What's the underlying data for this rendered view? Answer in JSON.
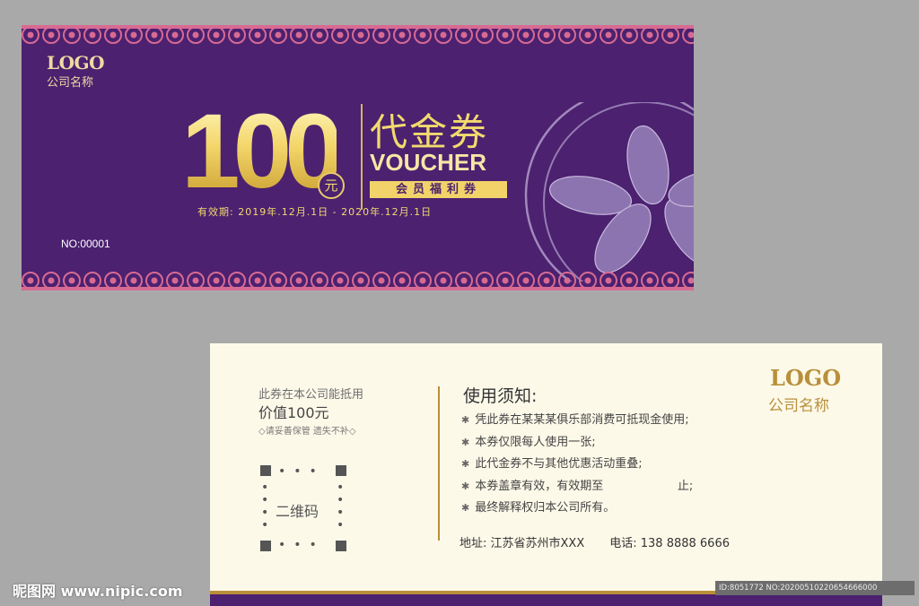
{
  "front": {
    "logo": "LOGO",
    "company": "公司名称",
    "amount": "100",
    "currency": "元",
    "title_cn": "代金券",
    "title_en": "VOUCHER",
    "member_label": "会员福利券",
    "validity": "有效期: 2019年.12月.1日  -  2020年.12月.1日",
    "serial": "NO:00001"
  },
  "back": {
    "value_line1": "此券在本公司能抵用",
    "value_line2": "价值100元",
    "keep_note": "◇请妥善保管 遗失不补◇",
    "qr_label": "二维码",
    "rules_title": "使用须知:",
    "rules": [
      "凭此券在某某某俱乐部消费可抵现金使用;",
      "本券仅限每人使用一张;",
      "此代金券不与其他优惠活动重叠;",
      "本券盖章有效，有效期至                    止;",
      "最终解释权归本公司所有。"
    ],
    "address": "地址: 江苏省苏州市XXX",
    "phone": "电话: 138 8888 6666",
    "logo": "LOGO",
    "company": "公司名称"
  },
  "watermark": {
    "left": "昵图网 www.nipic.com",
    "right": "ID:8051772 NO:20200510220654666000"
  },
  "colors": {
    "front_bg": "#4b2170",
    "gold": "#f2da6e",
    "lace_pink": "#d86a92",
    "back_bg": "#fdf9e9",
    "back_gold": "#b98f3a"
  }
}
